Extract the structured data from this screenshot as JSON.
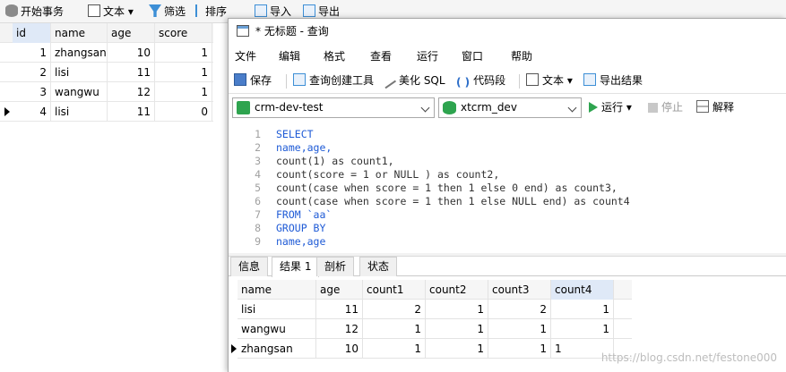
{
  "bg_toolbar": {
    "begin_tx": "开始事务",
    "text": "文本",
    "filter": "筛选",
    "sort": "排序",
    "import": "导入",
    "export": "导出"
  },
  "bg_table": {
    "columns": [
      "id",
      "name",
      "age",
      "score"
    ],
    "rows": [
      [
        "1",
        "zhangsan",
        "10",
        "1"
      ],
      [
        "2",
        "lisi",
        "11",
        "1"
      ],
      [
        "3",
        "wangwu",
        "12",
        "1"
      ],
      [
        "4",
        "lisi",
        "11",
        "0"
      ]
    ]
  },
  "query_window": {
    "title": "* 无标题 - 查询",
    "menu": [
      "文件",
      "编辑",
      "格式",
      "查看",
      "运行",
      "窗口",
      "帮助"
    ],
    "toolbar": {
      "save": "保存",
      "query_builder": "查询创建工具",
      "beautify": "美化 SQL",
      "snippet": "代码段",
      "text": "文本",
      "export_result": "导出结果"
    },
    "connection": "crm-dev-test",
    "database": "xtcrm_dev",
    "run": "运行",
    "stop": "停止",
    "explain": "解释",
    "sql_lines": [
      "SELECT",
      "name,age,",
      "count(1) as count1,",
      "count(score = 1 or NULL ) as count2,",
      "count(case when score = 1 then 1 else 0 end) as count3,",
      "count(case when score = 1 then 1 else NULL end) as count4",
      "FROM `aa`",
      "GROUP BY",
      "name,age"
    ],
    "tabs": [
      "信息",
      "结果 1",
      "剖析",
      "状态"
    ],
    "result": {
      "columns": [
        "name",
        "age",
        "count1",
        "count2",
        "count3",
        "count4"
      ],
      "rows": [
        [
          "lisi",
          "11",
          "2",
          "1",
          "2",
          "1"
        ],
        [
          "wangwu",
          "12",
          "1",
          "1",
          "1",
          "1"
        ],
        [
          "zhangsan",
          "10",
          "1",
          "1",
          "1",
          "1"
        ]
      ]
    }
  },
  "watermark": "https://blog.csdn.net/festone000"
}
